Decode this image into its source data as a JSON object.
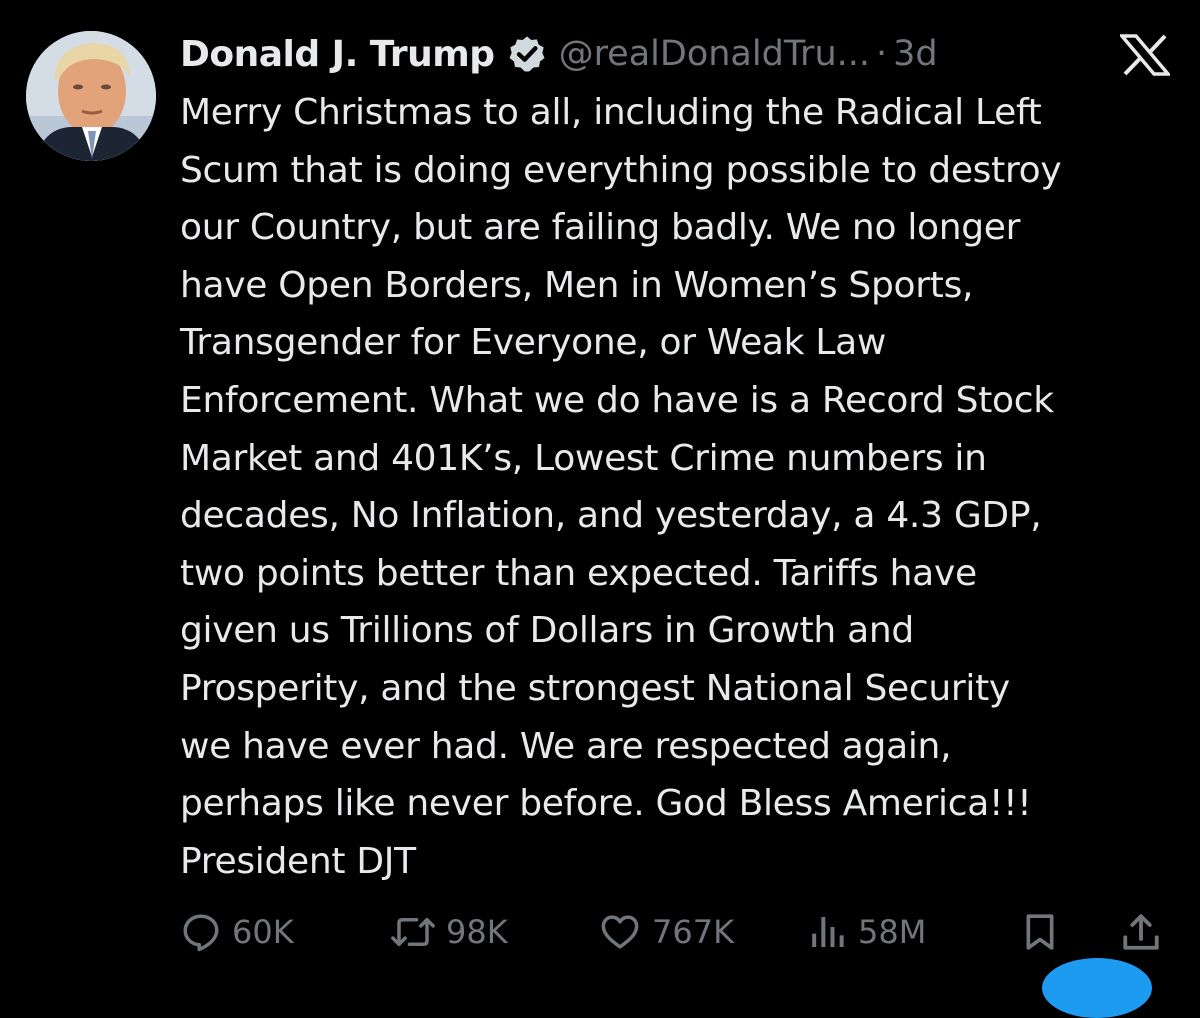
{
  "tweet": {
    "author_name": "Donald J. Trump",
    "handle": "@realDonaldTru...",
    "separator": "·",
    "timestamp": "3d",
    "lines": [
      "Merry Christmas to all, including the Radical Left",
      "Scum that is doing everything possible to destroy",
      "our Country, but are failing badly. We no longer",
      "have Open Borders, Men in Women’s Sports,",
      "Transgender for Everyone, or Weak Law",
      "Enforcement. What we do have is a Record Stock",
      "Market and 401K’s, Lowest Crime numbers in",
      "decades, No Inflation, and yesterday, a 4.3 GDP,",
      "two points better than expected. Tariffs have",
      "given us Trillions of Dollars in Growth and",
      "Prosperity, and the strongest National Security",
      "we have ever had. We are respected again,",
      "perhaps like never before. God Bless America!!!",
      "President DJT"
    ]
  },
  "actions": {
    "replies": "60K",
    "reposts": "98K",
    "likes": "767K",
    "views": "58M"
  },
  "icons": {
    "verified": "verified-badge-icon",
    "platform": "x-logo-icon",
    "reply": "reply-icon",
    "repost": "repost-icon",
    "like": "heart-icon",
    "views": "views-icon",
    "bookmark": "bookmark-icon",
    "share": "share-icon"
  },
  "colors": {
    "background": "#000000",
    "text": "#e7e9ea",
    "secondary": "#71767b",
    "accent": "#1d9bf0"
  }
}
